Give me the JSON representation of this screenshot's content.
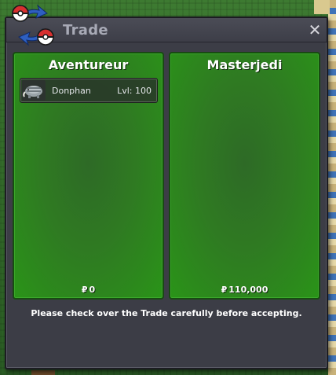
{
  "window": {
    "title": "Trade",
    "close_label": "✕",
    "notice": "Please check over the Trade carefully before accepting."
  },
  "trade": {
    "left": {
      "name": "Aventureur",
      "currency_symbol": "₽",
      "money": "0",
      "pokemon": [
        {
          "name": "Donphan",
          "level": "Lvl: 100"
        }
      ]
    },
    "right": {
      "name": "Masterjedi",
      "currency_symbol": "₽",
      "money": "110,000",
      "pokemon": []
    }
  },
  "colors": {
    "panel_green": "#2c8a1c",
    "window_bg": "#3c3d46",
    "pokeball_red": "#d83030",
    "arrow_blue": "#2e5fc0"
  },
  "icons": {
    "logo": "trade-pokeballs-icon",
    "close": "close-icon",
    "pokemon": "donphan-sprite-icon"
  }
}
